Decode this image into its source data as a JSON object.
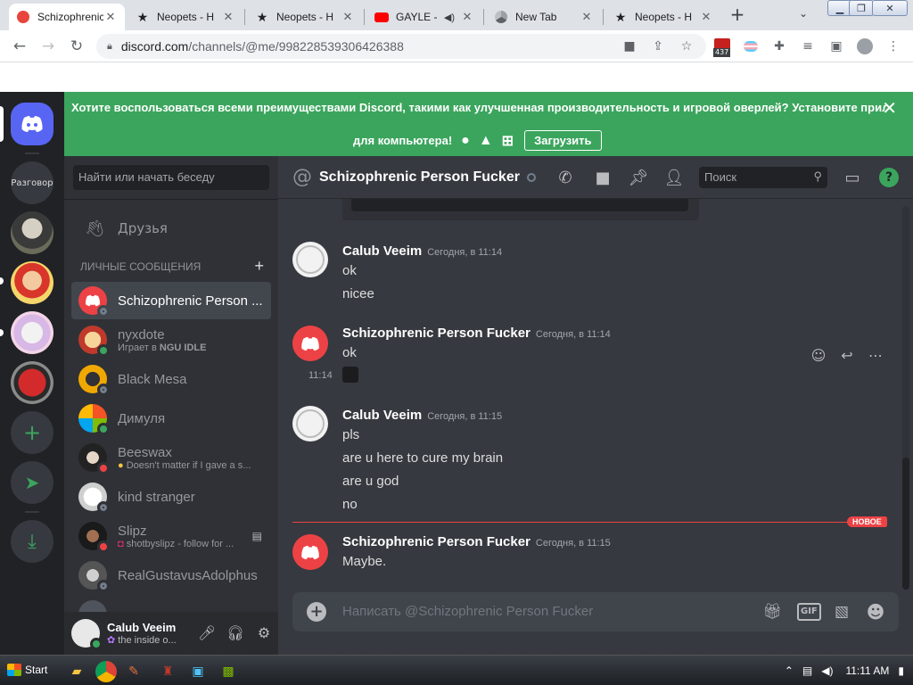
{
  "browser": {
    "tabs": [
      {
        "title": "Schizophrenic",
        "favicon": "discord-icon",
        "active": true
      },
      {
        "title": "Neopets - H",
        "favicon": "star-icon",
        "active": false
      },
      {
        "title": "Neopets - H",
        "favicon": "star-icon",
        "active": false
      },
      {
        "title": "GAYLE - ",
        "favicon": "youtube-icon",
        "active": false
      },
      {
        "title": "New Tab",
        "favicon": "chrome-icon",
        "active": false
      },
      {
        "title": "Neopets - H",
        "favicon": "star-icon",
        "active": false
      }
    ],
    "new_tab_label": "+",
    "url_host": "discord.com",
    "url_path": "/channels/@me/998228539306426388",
    "extension_badge": "437"
  },
  "banner": {
    "line1": "Хотите воспользоваться всеми преимуществами Discord, такими как улучшенная производительность и игровой оверлей? Установите приложение",
    "line2": "для компьютера!",
    "download_label": "Загрузить",
    "close_label": "✕"
  },
  "guilds": {
    "dm_home_icon": "discord-logo-icon",
    "server1_label": "Разговор"
  },
  "dmlist": {
    "search_placeholder": "Найти или начать беседу",
    "friends_label": "Друзья",
    "header_label": "ЛИЧНЫЕ СООБЩЕНИЯ",
    "header_add": "+",
    "items": [
      {
        "name": "Schizophrenic Person ...",
        "sub": "",
        "status": "offline",
        "selected": true
      },
      {
        "name": "nyxdote",
        "sub_prefix": "Играет в ",
        "sub_bold": "NGU IDLE",
        "status": "online"
      },
      {
        "name": "Black Mesa",
        "sub": "",
        "status": "offline"
      },
      {
        "name": "Димуля",
        "sub": "",
        "status": "online"
      },
      {
        "name": "Beeswax",
        "sub": "Doesn't matter if I gave a s...",
        "status": "dnd"
      },
      {
        "name": "kind stranger",
        "sub": "",
        "status": "offline"
      },
      {
        "name": "Slipz",
        "sub": "shotbyslipz - follow for ...",
        "status": "dnd"
      },
      {
        "name": "RealGustavusAdolphus",
        "sub": "",
        "status": "offline"
      }
    ]
  },
  "user": {
    "name": "Calub Veeim",
    "status_text": "the inside o..."
  },
  "chat": {
    "title": "Schizophrenic Person Fucker",
    "search_placeholder": "Поиск",
    "help_label": "?",
    "new_badge": "НОВОЕ",
    "composer_placeholder": "Написать @Schizophrenic Person Fucker",
    "composer_gif": "GIF",
    "messages": [
      {
        "author": "Calub Veeim",
        "time": "Сегодня, в 11:14",
        "lines": [
          "ok",
          "nicee"
        ]
      },
      {
        "author": "Schizophrenic Person Fucker",
        "time": "Сегодня, в 11:14",
        "lines": [
          "ok"
        ],
        "side_time": "11:14"
      },
      {
        "author": "Calub Veeim",
        "time": "Сегодня, в 11:15",
        "lines": [
          "pls",
          "are u here to cure my brain",
          "are u god",
          "no"
        ]
      },
      {
        "author": "Schizophrenic Person Fucker",
        "time": "Сегодня, в 11:15",
        "lines": [
          "Maybe."
        ]
      }
    ]
  },
  "taskbar": {
    "start_label": "Start",
    "clock": "11:11 AM"
  },
  "colors": {
    "discord_blurple": "#5865f2",
    "banner_green": "#3ba55d",
    "dnd_red": "#ed4245"
  }
}
